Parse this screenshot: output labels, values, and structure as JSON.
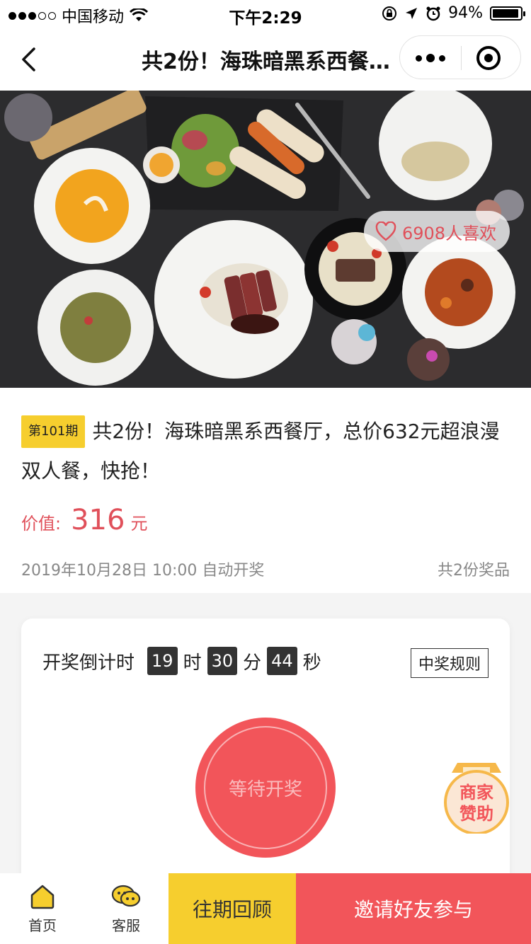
{
  "status_bar": {
    "carrier": "中国移动",
    "time": "下午2:29",
    "battery": "94%",
    "battery_level": 0.94
  },
  "nav": {
    "title": "共2份！海珠暗黑系西餐厅，总价632元超浪漫双人餐，快抢！"
  },
  "hero": {
    "likes_text": "6908人喜欢"
  },
  "prize": {
    "period_badge": "第101期",
    "title": "共2份！海珠暗黑系西餐厅，总价632元超浪漫双人餐，快抢！",
    "price_label": "价值:",
    "price_value": "316",
    "price_unit": "元",
    "draw_time": "2019年10月28日 10:00 自动开奖",
    "prize_count": "共2份奖品"
  },
  "countdown": {
    "label": "开奖倒计时",
    "hours": "19",
    "hours_unit": "时",
    "minutes": "30",
    "minutes_unit": "分",
    "seconds": "44",
    "seconds_unit": "秒",
    "rules_label": "中奖规则",
    "action_label": "等待开奖"
  },
  "sponsor": {
    "line1": "商家",
    "line2": "赞助"
  },
  "tabbar": {
    "home": "首页",
    "service": "客服",
    "history": "往期回顾",
    "invite": "邀请好友参与"
  },
  "colors": {
    "accent_red": "#f2555a",
    "accent_yellow": "#f6ce2e",
    "price_red": "#e0505a"
  }
}
